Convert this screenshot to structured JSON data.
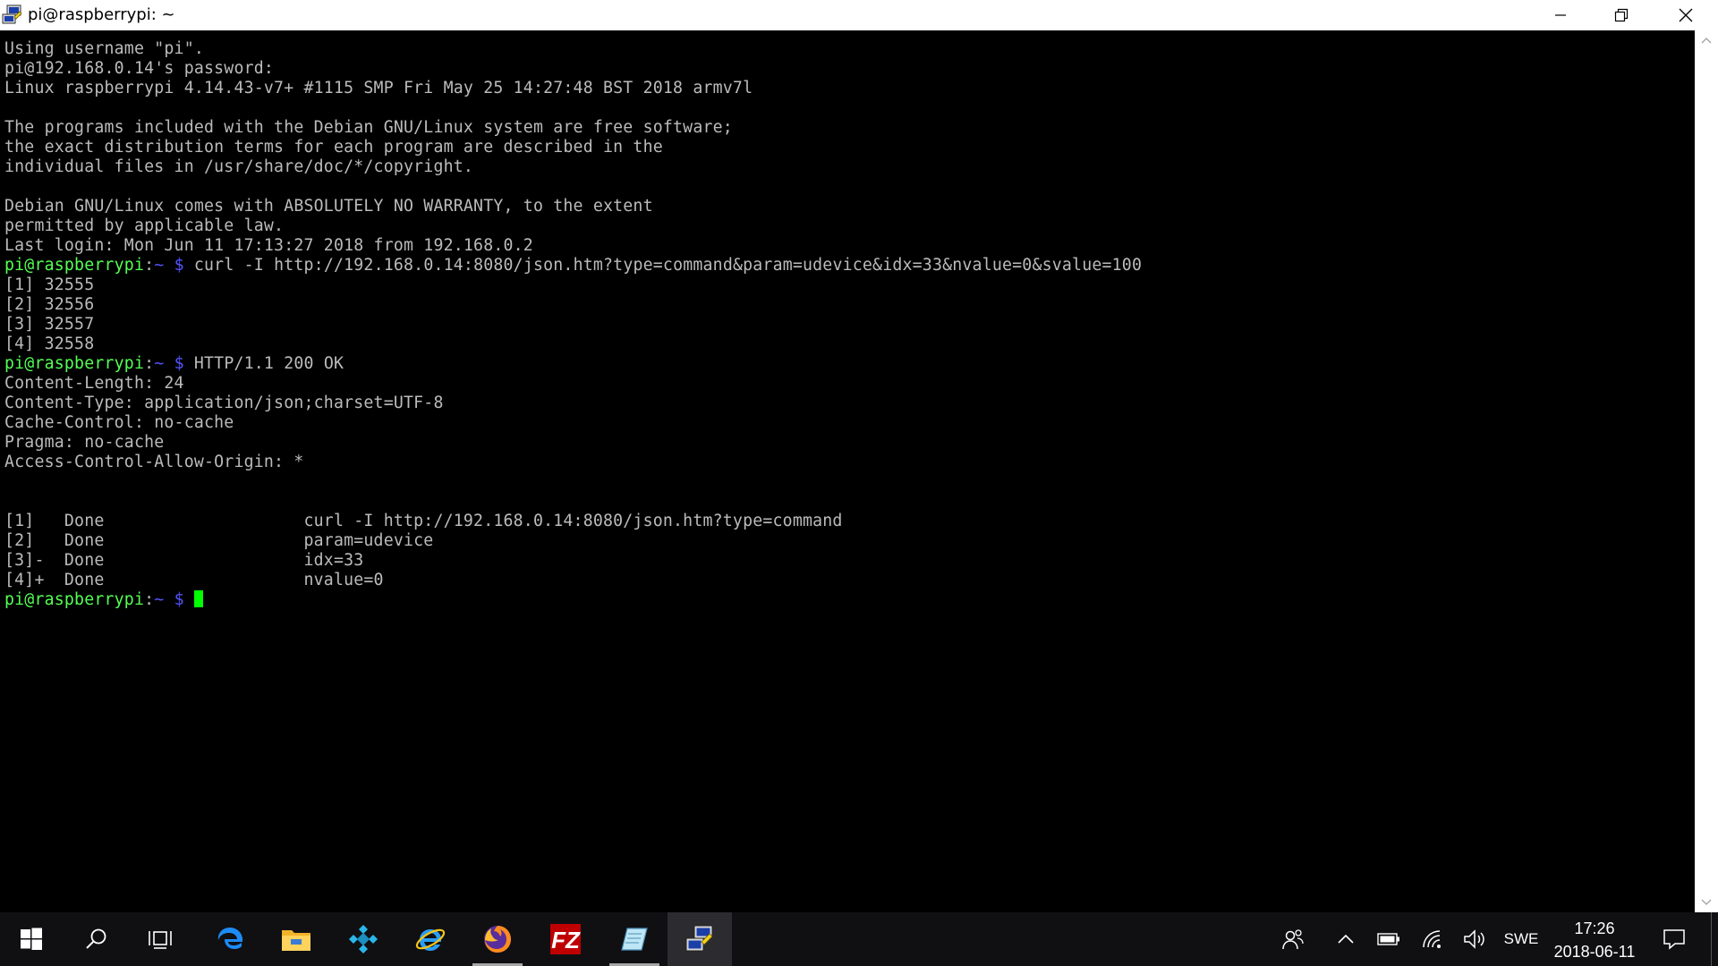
{
  "window": {
    "title": "pi@raspberrypi: ~"
  },
  "colors": {
    "prompt_user": "#54ff54",
    "prompt_path": "#5454ff",
    "text": "#bbbbbb",
    "cursor": "#00ff00",
    "taskbar": "#101013"
  },
  "terminal": {
    "lines": {
      "l01": "Using username \"pi\".",
      "l02": "pi@192.168.0.14's password:",
      "l03": "Linux raspberrypi 4.14.43-v7+ #1115 SMP Fri May 25 14:27:48 BST 2018 armv7l",
      "l05": "The programs included with the Debian GNU/Linux system are free software;",
      "l06": "the exact distribution terms for each program are described in the",
      "l07": "individual files in /usr/share/doc/*/copyright.",
      "l09": "Debian GNU/Linux comes with ABSOLUTELY NO WARRANTY, to the extent",
      "l10": "permitted by applicable law.",
      "l11": "Last login: Mon Jun 11 17:13:27 2018 from 192.168.0.2",
      "l12_cmd": "curl -I http://192.168.0.14:8080/json.htm?type=command&param=udevice&idx=33&nvalue=0&svalue=100",
      "l13": "[1] 32555",
      "l14": "[2] 32556",
      "l15": "[3] 32557",
      "l16": "[4] 32558",
      "l17_cmd": "HTTP/1.1 200 OK",
      "l18": "Content-Length: 24",
      "l19": "Content-Type: application/json;charset=UTF-8",
      "l20": "Cache-Control: no-cache",
      "l21": "Pragma: no-cache",
      "l22": "Access-Control-Allow-Origin: *",
      "l25": "[1]   Done                    curl -I http://192.168.0.14:8080/json.htm?type=command",
      "l26": "[2]   Done                    param=udevice",
      "l27": "[3]-  Done                    idx=33",
      "l28": "[4]+  Done                    nvalue=0"
    },
    "prompt": {
      "user": "pi@raspberrypi",
      "sep": ":",
      "path": "~",
      "symbol": " $ "
    }
  },
  "taskbar": {
    "apps": [
      {
        "name": "task-view",
        "icon": "task-view-icon"
      },
      {
        "name": "edge",
        "icon": "edge-icon"
      },
      {
        "name": "file-explorer",
        "icon": "folder-icon"
      },
      {
        "name": "kodi",
        "icon": "kodi-icon"
      },
      {
        "name": "internet-explorer",
        "icon": "ie-icon"
      },
      {
        "name": "firefox",
        "icon": "firefox-icon"
      },
      {
        "name": "filezilla",
        "icon": "filezilla-icon"
      },
      {
        "name": "notepad",
        "icon": "notepad-icon"
      },
      {
        "name": "putty",
        "icon": "putty-icon"
      }
    ],
    "language": "SWE",
    "clock": {
      "time": "17:26",
      "date": "2018-06-11"
    }
  }
}
